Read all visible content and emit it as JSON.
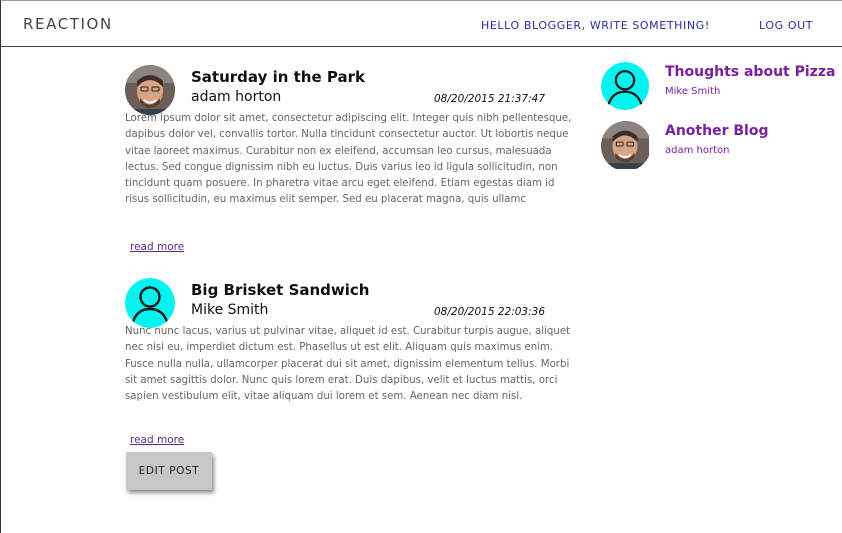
{
  "header": {
    "brand": "REACTION",
    "write_link": "HELLO BLOGGER, WRITE SOMETHING!",
    "logout_link": "LOG OUT"
  },
  "posts": [
    {
      "title": "Saturday in the Park",
      "author": "adam horton",
      "date": "08/20/2015 21:37:47",
      "avatar": "photo-avatar",
      "body": "Lorem ipsum dolor sit amet, consectetur adipiscing elit. Integer quis nibh pellentesque, dapibus dolor vel, convallis tortor. Nulla tincidunt consectetur auctor. Ut lobortis neque vitae laoreet maximus. Curabitur non ex eleifend, accumsan leo cursus, malesuada lectus. Sed congue dignissim nibh eu luctus. Duis varius leo id ligula sollicitudin, non tincidunt quam posuere. In pharetra vitae arcu eget eleifend. Etiam egestas diam id risus sollicitudin, eu maximus elit semper. Sed eu placerat magna, quis ullamc",
      "read_more": "read more"
    },
    {
      "title": "Big Brisket Sandwich",
      "author": "Mike Smith",
      "date": "08/20/2015 22:03:36",
      "avatar": "default-user-avatar",
      "body": "Nunc nunc lacus, varius ut pulvinar vitae, aliquet id est. Curabitur turpis augue, aliquet nec nisi eu, imperdiet dictum est. Phasellus ut est elit. Aliquam quis maximus enim. Fusce nulla nulla, ullamcorper placerat dui sit amet, dignissim elementum tellus. Morbi sit amet sagittis dolor. Nunc quis lorem erat. Duis dapibus, velit et luctus mattis, orci sapien vestibulum elit, vitae aliquam dui lorem et sem. Aenean nec diam nisl.",
      "read_more": "read more",
      "edit_label": "EDIT POST"
    }
  ],
  "sidebar": [
    {
      "title": "Thoughts about Pizza",
      "author": "Mike Smith",
      "avatar": "default-user-avatar"
    },
    {
      "title": "Another Blog",
      "author": "adam horton",
      "avatar": "photo-avatar"
    }
  ],
  "colors": {
    "nav_link": "#2c2ca6",
    "sidebar_link": "#7a1fa0",
    "read_more": "#5a2a8c",
    "default_avatar_bg": "#00f5f0",
    "button_bg": "#c7c7c7"
  }
}
